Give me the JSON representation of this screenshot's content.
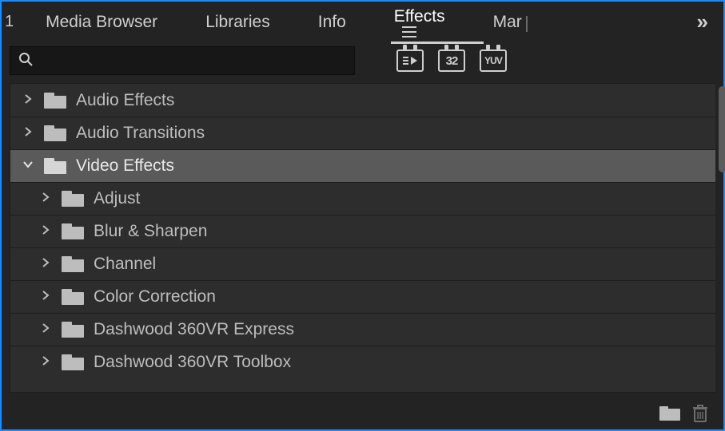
{
  "tabs": {
    "lead_marker": "1",
    "items": [
      {
        "label": "Media Browser"
      },
      {
        "label": "Libraries"
      },
      {
        "label": "Info"
      },
      {
        "label": "Effects",
        "active": true
      },
      {
        "label": "Mar",
        "truncated": true
      }
    ]
  },
  "search": {
    "placeholder": ""
  },
  "filter_icons": {
    "accelerated": "⏵",
    "bitdepth": "32",
    "yuv": "YUV"
  },
  "tree": [
    {
      "label": "Audio Effects",
      "expanded": false,
      "depth": 0
    },
    {
      "label": "Audio Transitions",
      "expanded": false,
      "depth": 0
    },
    {
      "label": "Video Effects",
      "expanded": true,
      "depth": 0,
      "selected": true
    },
    {
      "label": "Adjust",
      "expanded": false,
      "depth": 1
    },
    {
      "label": "Blur & Sharpen",
      "expanded": false,
      "depth": 1
    },
    {
      "label": "Channel",
      "expanded": false,
      "depth": 1
    },
    {
      "label": "Color Correction",
      "expanded": false,
      "depth": 1
    },
    {
      "label": "Dashwood 360VR Express",
      "expanded": false,
      "depth": 1
    },
    {
      "label": "Dashwood 360VR Toolbox",
      "expanded": false,
      "depth": 1
    }
  ]
}
